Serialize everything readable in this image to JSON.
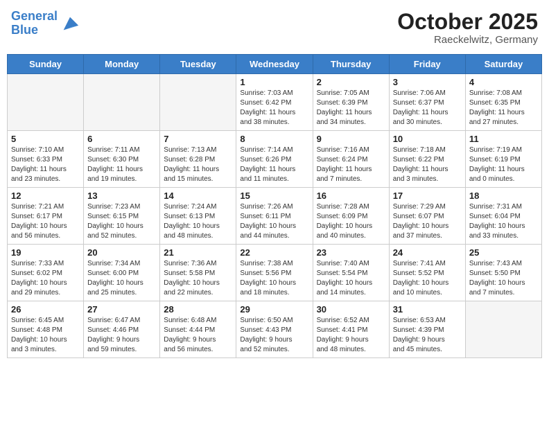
{
  "header": {
    "logo_line1": "General",
    "logo_line2": "Blue",
    "month": "October 2025",
    "location": "Raeckelwitz, Germany"
  },
  "days_of_week": [
    "Sunday",
    "Monday",
    "Tuesday",
    "Wednesday",
    "Thursday",
    "Friday",
    "Saturday"
  ],
  "weeks": [
    [
      {
        "day": "",
        "info": ""
      },
      {
        "day": "",
        "info": ""
      },
      {
        "day": "",
        "info": ""
      },
      {
        "day": "1",
        "info": "Sunrise: 7:03 AM\nSunset: 6:42 PM\nDaylight: 11 hours\nand 38 minutes."
      },
      {
        "day": "2",
        "info": "Sunrise: 7:05 AM\nSunset: 6:39 PM\nDaylight: 11 hours\nand 34 minutes."
      },
      {
        "day": "3",
        "info": "Sunrise: 7:06 AM\nSunset: 6:37 PM\nDaylight: 11 hours\nand 30 minutes."
      },
      {
        "day": "4",
        "info": "Sunrise: 7:08 AM\nSunset: 6:35 PM\nDaylight: 11 hours\nand 27 minutes."
      }
    ],
    [
      {
        "day": "5",
        "info": "Sunrise: 7:10 AM\nSunset: 6:33 PM\nDaylight: 11 hours\nand 23 minutes."
      },
      {
        "day": "6",
        "info": "Sunrise: 7:11 AM\nSunset: 6:30 PM\nDaylight: 11 hours\nand 19 minutes."
      },
      {
        "day": "7",
        "info": "Sunrise: 7:13 AM\nSunset: 6:28 PM\nDaylight: 11 hours\nand 15 minutes."
      },
      {
        "day": "8",
        "info": "Sunrise: 7:14 AM\nSunset: 6:26 PM\nDaylight: 11 hours\nand 11 minutes."
      },
      {
        "day": "9",
        "info": "Sunrise: 7:16 AM\nSunset: 6:24 PM\nDaylight: 11 hours\nand 7 minutes."
      },
      {
        "day": "10",
        "info": "Sunrise: 7:18 AM\nSunset: 6:22 PM\nDaylight: 11 hours\nand 3 minutes."
      },
      {
        "day": "11",
        "info": "Sunrise: 7:19 AM\nSunset: 6:19 PM\nDaylight: 11 hours\nand 0 minutes."
      }
    ],
    [
      {
        "day": "12",
        "info": "Sunrise: 7:21 AM\nSunset: 6:17 PM\nDaylight: 10 hours\nand 56 minutes."
      },
      {
        "day": "13",
        "info": "Sunrise: 7:23 AM\nSunset: 6:15 PM\nDaylight: 10 hours\nand 52 minutes."
      },
      {
        "day": "14",
        "info": "Sunrise: 7:24 AM\nSunset: 6:13 PM\nDaylight: 10 hours\nand 48 minutes."
      },
      {
        "day": "15",
        "info": "Sunrise: 7:26 AM\nSunset: 6:11 PM\nDaylight: 10 hours\nand 44 minutes."
      },
      {
        "day": "16",
        "info": "Sunrise: 7:28 AM\nSunset: 6:09 PM\nDaylight: 10 hours\nand 40 minutes."
      },
      {
        "day": "17",
        "info": "Sunrise: 7:29 AM\nSunset: 6:07 PM\nDaylight: 10 hours\nand 37 minutes."
      },
      {
        "day": "18",
        "info": "Sunrise: 7:31 AM\nSunset: 6:04 PM\nDaylight: 10 hours\nand 33 minutes."
      }
    ],
    [
      {
        "day": "19",
        "info": "Sunrise: 7:33 AM\nSunset: 6:02 PM\nDaylight: 10 hours\nand 29 minutes."
      },
      {
        "day": "20",
        "info": "Sunrise: 7:34 AM\nSunset: 6:00 PM\nDaylight: 10 hours\nand 25 minutes."
      },
      {
        "day": "21",
        "info": "Sunrise: 7:36 AM\nSunset: 5:58 PM\nDaylight: 10 hours\nand 22 minutes."
      },
      {
        "day": "22",
        "info": "Sunrise: 7:38 AM\nSunset: 5:56 PM\nDaylight: 10 hours\nand 18 minutes."
      },
      {
        "day": "23",
        "info": "Sunrise: 7:40 AM\nSunset: 5:54 PM\nDaylight: 10 hours\nand 14 minutes."
      },
      {
        "day": "24",
        "info": "Sunrise: 7:41 AM\nSunset: 5:52 PM\nDaylight: 10 hours\nand 10 minutes."
      },
      {
        "day": "25",
        "info": "Sunrise: 7:43 AM\nSunset: 5:50 PM\nDaylight: 10 hours\nand 7 minutes."
      }
    ],
    [
      {
        "day": "26",
        "info": "Sunrise: 6:45 AM\nSunset: 4:48 PM\nDaylight: 10 hours\nand 3 minutes."
      },
      {
        "day": "27",
        "info": "Sunrise: 6:47 AM\nSunset: 4:46 PM\nDaylight: 9 hours\nand 59 minutes."
      },
      {
        "day": "28",
        "info": "Sunrise: 6:48 AM\nSunset: 4:44 PM\nDaylight: 9 hours\nand 56 minutes."
      },
      {
        "day": "29",
        "info": "Sunrise: 6:50 AM\nSunset: 4:43 PM\nDaylight: 9 hours\nand 52 minutes."
      },
      {
        "day": "30",
        "info": "Sunrise: 6:52 AM\nSunset: 4:41 PM\nDaylight: 9 hours\nand 48 minutes."
      },
      {
        "day": "31",
        "info": "Sunrise: 6:53 AM\nSunset: 4:39 PM\nDaylight: 9 hours\nand 45 minutes."
      },
      {
        "day": "",
        "info": ""
      }
    ]
  ]
}
